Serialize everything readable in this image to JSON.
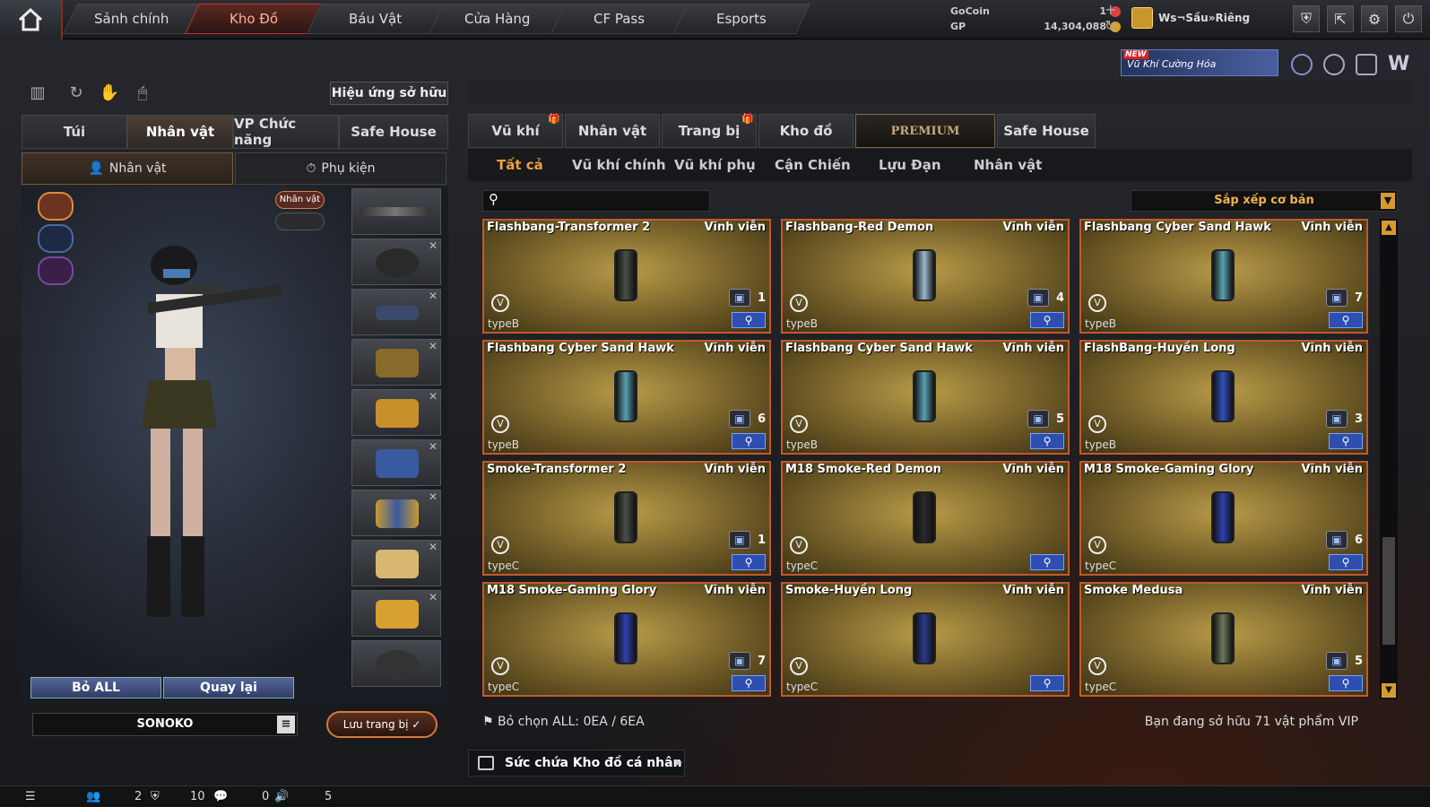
{
  "topnav": {
    "items": [
      "Sảnh chính",
      "Kho Đồ",
      "Báu Vật",
      "Cửa Hàng",
      "CF Pass",
      "Esports"
    ],
    "active": "Kho Đồ"
  },
  "currency": {
    "gocoin_label": "GoCoin",
    "gocoin_value": "1",
    "gp_label": "GP",
    "gp_value": "14,304,088"
  },
  "user": {
    "name": "Ws¬Sầu»Riêng"
  },
  "banner": {
    "new_label": "NEW",
    "text": "Vũ Khí Cường Hóa"
  },
  "left": {
    "effect_button": "Hiệu ứng sở hữu",
    "tabs": [
      "Túi",
      "Nhân vật",
      "VP Chức năng",
      "Safe House"
    ],
    "active_tab": "Nhân vật",
    "subtabs": [
      "Nhân vật",
      "Phụ kiện"
    ],
    "char_tag": "Nhân vật ✓",
    "bo_all": "Bỏ ALL",
    "quay_lai": "Quay lại",
    "character_name": "SONOKO",
    "save": "Lưu trang bị ✓"
  },
  "right": {
    "tabs": [
      "Vũ khí",
      "Nhân vật",
      "Trang bị",
      "Kho đồ",
      "PREMIUM",
      "Safe House"
    ],
    "active_tab": "PREMIUM",
    "subtabs": [
      "Tất cả",
      "Vũ khí chính",
      "Vũ khí phụ",
      "Cận Chiến",
      "Lựu Đạn",
      "Nhân vật"
    ],
    "active_subtab": "Tất cả",
    "sort_label": "Sắp xếp cơ bản",
    "items": [
      {
        "name": "Flashbang-Transformer 2",
        "perm": "Vĩnh viễn",
        "type": "typeB",
        "qty": "1",
        "color": "#4a5048"
      },
      {
        "name": "Flashbang-Red Demon",
        "perm": "Vĩnh viễn",
        "type": "typeB",
        "qty": "4",
        "color": "#9ab8cc"
      },
      {
        "name": "Flashbang Cyber Sand Hawk",
        "perm": "Vĩnh viễn",
        "type": "typeB",
        "qty": "7",
        "color": "#5aa0b0"
      },
      {
        "name": "Flashbang Cyber Sand Hawk",
        "perm": "Vĩnh viễn",
        "type": "typeB",
        "qty": "6",
        "color": "#5aa0b0"
      },
      {
        "name": "Flashbang Cyber Sand Hawk",
        "perm": "Vĩnh viễn",
        "type": "typeB",
        "qty": "5",
        "color": "#5aa0b0"
      },
      {
        "name": "FlashBang-Huyền Long",
        "perm": "Vĩnh viễn",
        "type": "typeB",
        "qty": "3",
        "color": "#3050c0"
      },
      {
        "name": "Smoke-Transformer 2",
        "perm": "Vĩnh viễn",
        "type": "typeC",
        "qty": "1",
        "color": "#4a5048"
      },
      {
        "name": "M18 Smoke-Red Demon",
        "perm": "Vĩnh viễn",
        "type": "typeC",
        "qty": "",
        "color": "#2a2a2e"
      },
      {
        "name": "M18 Smoke-Gaming Glory",
        "perm": "Vĩnh viễn",
        "type": "typeC",
        "qty": "6",
        "color": "#3040b0"
      },
      {
        "name": "M18 Smoke-Gaming Glory",
        "perm": "Vĩnh viễn",
        "type": "typeC",
        "qty": "7",
        "color": "#3040b0"
      },
      {
        "name": "Smoke-Huyền Long",
        "perm": "Vĩnh viễn",
        "type": "typeC",
        "qty": "",
        "color": "#2a3a8a"
      },
      {
        "name": "Smoke Medusa",
        "perm": "Vĩnh viễn",
        "type": "typeC",
        "qty": "5",
        "color": "#6a7a5a"
      }
    ],
    "deselect": "Bỏ chọn ALL: 0EA / 6EA",
    "owned": "Bạn đang sở hữu 71 vật phẩm VIP",
    "storage": "Sức chứa Kho đồ cá nhân"
  },
  "status": {
    "a": "2",
    "b": "10",
    "c": "0",
    "d": "5"
  }
}
